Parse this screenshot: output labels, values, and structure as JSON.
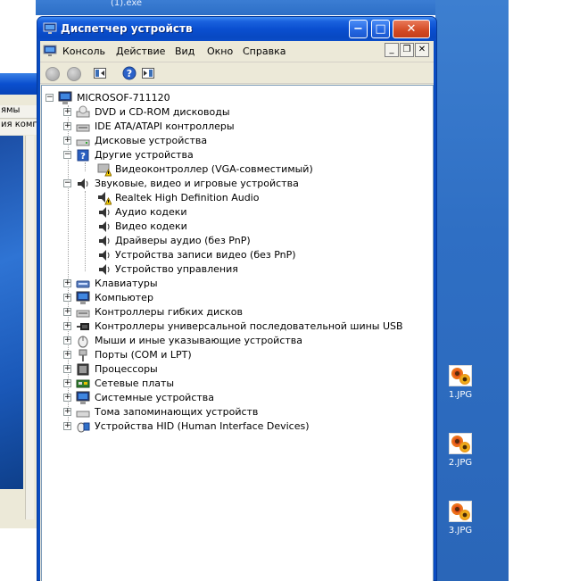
{
  "desktop": {
    "top_label": "(1).exe",
    "icons": [
      {
        "label": "1.JPG"
      },
      {
        "label": "2.JPG"
      },
      {
        "label": "3.JPG"
      }
    ]
  },
  "background_window": {
    "menu_text": "ямы",
    "menu_text2": "ия комп"
  },
  "window": {
    "title": "Диспетчер устройств",
    "buttons": {
      "minimize": "−",
      "maximize": "□",
      "close": "✕"
    }
  },
  "menubar": {
    "items": [
      "Консоль",
      "Действие",
      "Вид",
      "Окно",
      "Справка"
    ],
    "mdi": {
      "min": "_",
      "restore": "❐",
      "close": "✕"
    }
  },
  "tree": {
    "root": "MICROSOF-711120",
    "items": [
      {
        "label": "DVD и CD-ROM дисководы",
        "icon": "cdrom-icon",
        "expander": "+"
      },
      {
        "label": "IDE ATA/ATAPI контроллеры",
        "icon": "ide-controller-icon",
        "expander": "+"
      },
      {
        "label": "Дисковые устройства",
        "icon": "disk-drive-icon",
        "expander": "+"
      },
      {
        "label": "Другие устройства",
        "icon": "unknown-device-icon",
        "expander": "−",
        "children": [
          {
            "label": "Видеоконтроллер (VGA-совместимый)",
            "icon": "warning-device-icon"
          }
        ]
      },
      {
        "label": "Звуковые, видео и игровые устройства",
        "icon": "sound-device-icon",
        "expander": "−",
        "children": [
          {
            "label": "Realtek High Definition Audio",
            "icon": "warning-sound-icon"
          },
          {
            "label": "Аудио кодеки",
            "icon": "sound-device-icon"
          },
          {
            "label": "Видео кодеки",
            "icon": "sound-device-icon"
          },
          {
            "label": "Драйверы аудио (без PnP)",
            "icon": "sound-device-icon"
          },
          {
            "label": "Устройства записи видео (без PnP)",
            "icon": "sound-device-icon"
          },
          {
            "label": "Устройство управления",
            "icon": "sound-device-icon"
          }
        ]
      },
      {
        "label": "Клавиатуры",
        "icon": "keyboard-icon",
        "expander": "+"
      },
      {
        "label": "Компьютер",
        "icon": "computer-icon",
        "expander": "+"
      },
      {
        "label": "Контроллеры гибких дисков",
        "icon": "floppy-controller-icon",
        "expander": "+"
      },
      {
        "label": "Контроллеры универсальной последовательной шины USB",
        "icon": "usb-icon",
        "expander": "+"
      },
      {
        "label": "Мыши и иные указывающие устройства",
        "icon": "mouse-icon",
        "expander": "+"
      },
      {
        "label": "Порты (COM и LPT)",
        "icon": "port-icon",
        "expander": "+"
      },
      {
        "label": "Процессоры",
        "icon": "processor-icon",
        "expander": "+"
      },
      {
        "label": "Сетевые платы",
        "icon": "network-card-icon",
        "expander": "+"
      },
      {
        "label": "Системные устройства",
        "icon": "system-device-icon",
        "expander": "+"
      },
      {
        "label": "Тома запоминающих устройств",
        "icon": "storage-volume-icon",
        "expander": "+"
      },
      {
        "label": "Устройства HID (Human Interface Devices)",
        "icon": "hid-icon",
        "expander": "+"
      }
    ]
  }
}
